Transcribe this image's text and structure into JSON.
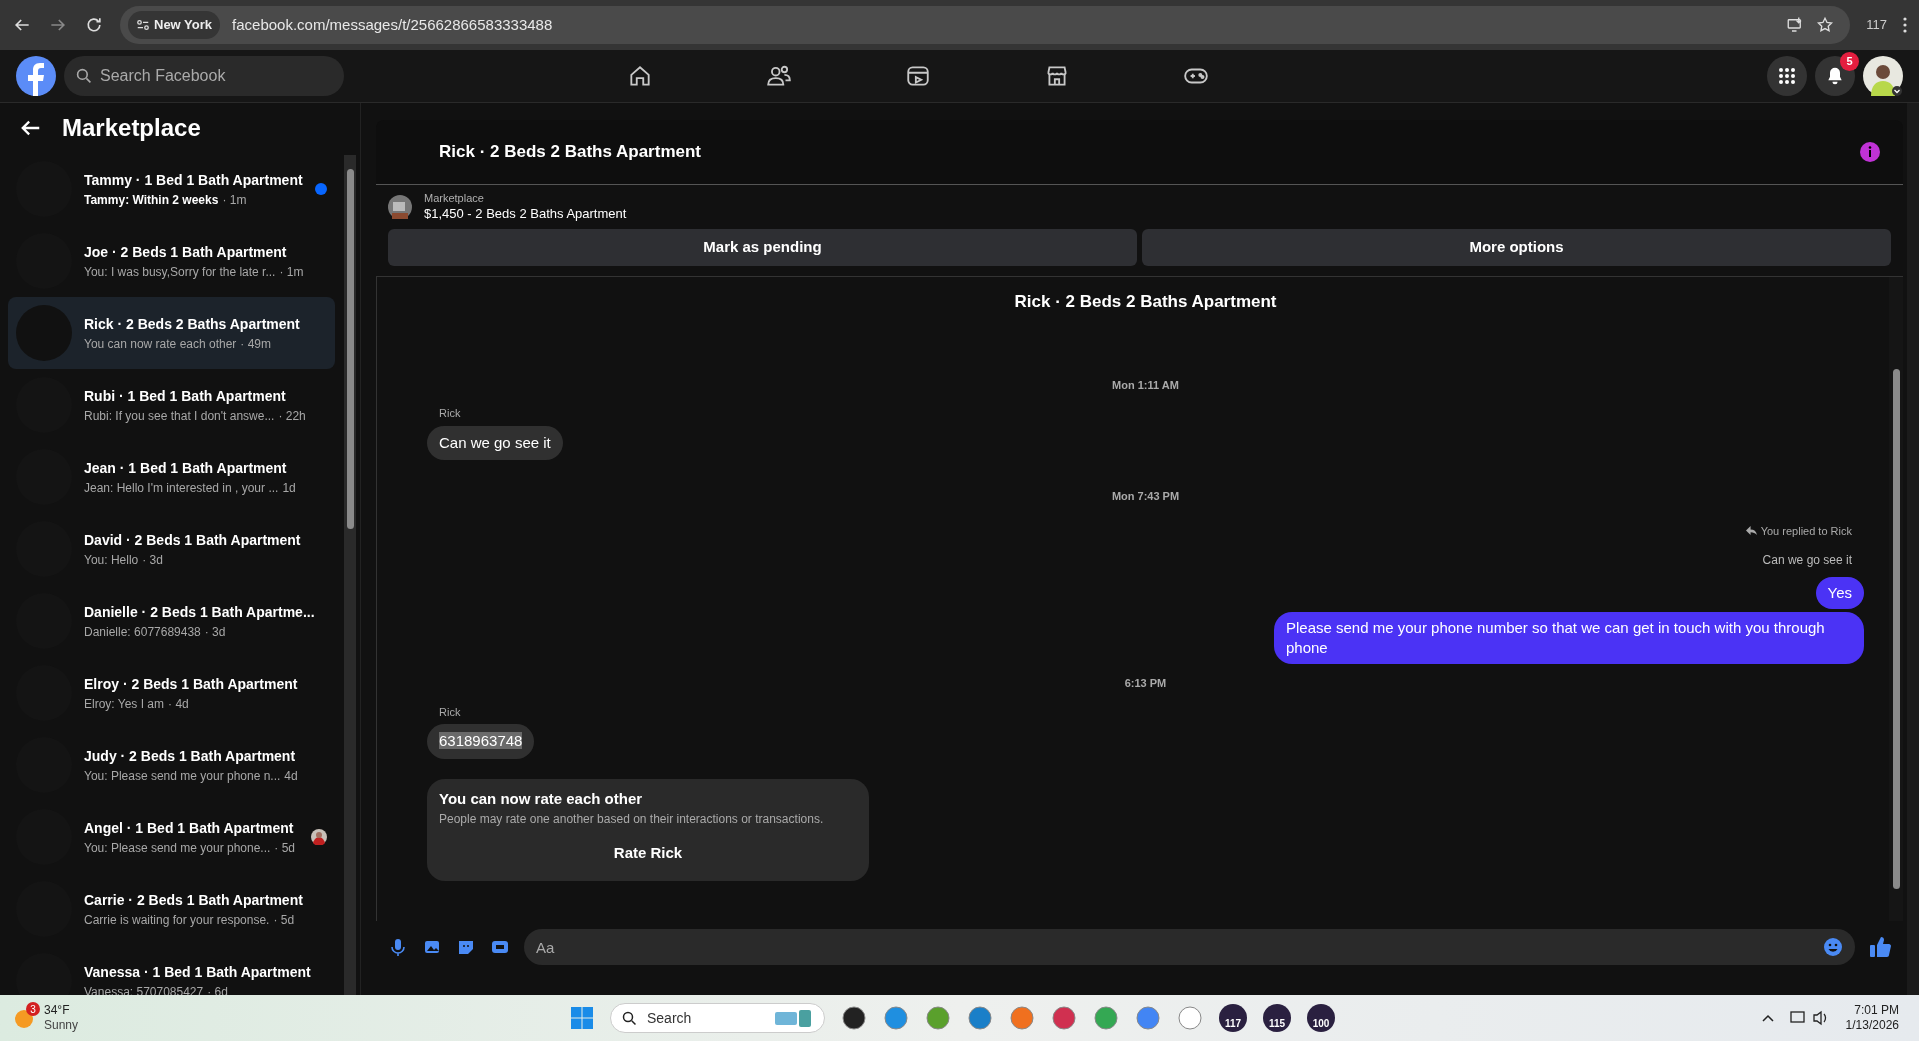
{
  "browser": {
    "location_chip": "New York",
    "url": "facebook.com/messages/t/25662866583333488",
    "extension_count": "117"
  },
  "topbar": {
    "search": {
      "placeholder": "Search Facebook"
    },
    "notification_count": "5"
  },
  "sidebar": {
    "title": "Marketplace",
    "conversations": [
      {
        "title": "Tammy · 1 Bed 1 Bath Apartment",
        "preview": "Tammy: Within 2 weeks",
        "time": "· 1m",
        "unread": true,
        "selected": false,
        "kind": "unread_dot"
      },
      {
        "title": "Joe · 2 Beds 1 Bath Apartment",
        "preview": "You: I was busy,Sorry for the late r...",
        "time": "· 1m",
        "unread": false,
        "selected": false
      },
      {
        "title": "Rick · 2 Beds 2 Baths Apartment",
        "preview": "You can now rate each other",
        "time": "· 49m",
        "unread": false,
        "selected": true
      },
      {
        "title": "Rubi · 1 Bed 1 Bath Apartment",
        "preview": "Rubi: If you see that I don't answe...",
        "time": "· 22h",
        "unread": false,
        "selected": false
      },
      {
        "title": "Jean · 1 Bed 1 Bath Apartment",
        "preview": "Jean: Hello I'm interested in , your ...",
        "time": "1d",
        "unread": false,
        "selected": false
      },
      {
        "title": "David · 2 Beds 1 Bath Apartment",
        "preview": "You: Hello",
        "time": "· 3d",
        "unread": false,
        "selected": false
      },
      {
        "title": "Danielle · 2 Beds 1 Bath Apartme...",
        "preview": "Danielle: 6077689438",
        "time": "· 3d",
        "unread": false,
        "selected": false
      },
      {
        "title": "Elroy · 2 Beds 1 Bath Apartment",
        "preview": "Elroy: Yes I am",
        "time": "· 4d",
        "unread": false,
        "selected": false
      },
      {
        "title": "Judy · 2 Beds 1 Bath Apartment",
        "preview": "You: Please send me your phone n...",
        "time": "4d",
        "unread": false,
        "selected": false
      },
      {
        "title": "Angel · 1 Bed 1 Bath Apartment",
        "preview": "You: Please send me your phone...",
        "time": "· 5d",
        "unread": false,
        "selected": false,
        "kind": "seen_avatar"
      },
      {
        "title": "Carrie · 2 Beds 1 Bath Apartment",
        "preview": "Carrie is waiting for your response.",
        "time": "· 5d",
        "unread": false,
        "selected": false
      },
      {
        "title": "Vanessa · 1 Bed 1 Bath Apartment",
        "preview": "Vanessa: 5707085427",
        "time": "· 6d",
        "unread": false,
        "selected": false
      }
    ]
  },
  "chat": {
    "title": "Rick · 2 Beds 2 Baths Apartment",
    "listing": {
      "label": "Marketplace",
      "name": "$1,450 - 2 Beds 2 Baths Apartment"
    },
    "actions": [
      "Mark as pending",
      "More options"
    ],
    "thread_title": "Rick · 2 Beds 2 Baths Apartment",
    "messages": [
      {
        "kind": "time",
        "text": "Mon 1:11 AM"
      },
      {
        "kind": "sender",
        "text": "Rick"
      },
      {
        "kind": "in",
        "text": "Can we go see it",
        "highlighted": false
      },
      {
        "kind": "time",
        "text": "Mon 7:43 PM"
      },
      {
        "kind": "reply_note",
        "text": "You replied to Rick"
      },
      {
        "kind": "quoted",
        "text": "Can we go see it"
      },
      {
        "kind": "out",
        "text": "Yes"
      },
      {
        "kind": "out",
        "text": "Please send me your phone  number so that we can get in touch with you through phone"
      },
      {
        "kind": "time",
        "text": "6:13 PM"
      },
      {
        "kind": "sender",
        "text": "Rick"
      },
      {
        "kind": "in",
        "text": "6318963748",
        "highlighted": true
      },
      {
        "kind": "card",
        "title": "You can now rate each other",
        "text": "People may rate one another based on their interactions or transactions.",
        "button": "Rate Rick"
      }
    ],
    "composer": {
      "placeholder": "Aa"
    }
  },
  "taskbar": {
    "weather": {
      "badge": "3",
      "temp": "34°F",
      "condition": "Sunny"
    },
    "search": {
      "placeholder": "Search"
    },
    "app_counts": [
      "117",
      "115",
      "100"
    ],
    "time": "7:01 PM",
    "date": "1/13/2026"
  }
}
